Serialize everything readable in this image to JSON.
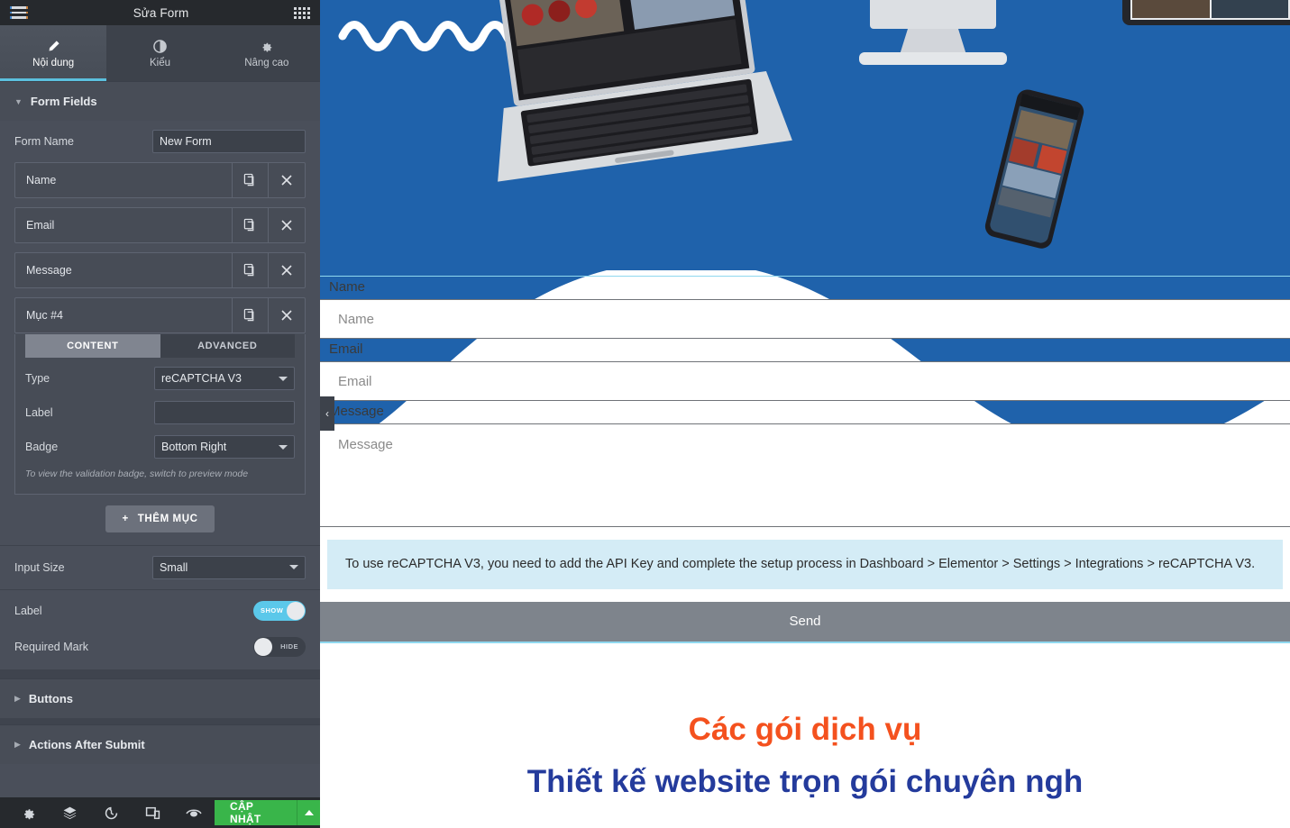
{
  "panel": {
    "header": {
      "title": "Sửa Form",
      "menu_icon": "hamburger-icon",
      "apps_icon": "grid-apps-icon"
    },
    "tabs": [
      {
        "label": "Nội dung",
        "icon": "pencil-icon",
        "active": true
      },
      {
        "label": "Kiểu",
        "icon": "contrast-half-circle-icon",
        "active": false
      },
      {
        "label": "Nâng cao",
        "icon": "gear-icon",
        "active": false
      }
    ],
    "sections": {
      "form_fields": {
        "title": "Form Fields",
        "expanded": true
      },
      "buttons": {
        "title": "Buttons",
        "expanded": false
      },
      "actions_after_submit": {
        "title": "Actions After Submit",
        "expanded": false
      }
    },
    "form_name": {
      "label": "Form Name",
      "value": "New Form"
    },
    "fields": [
      {
        "name": "Name"
      },
      {
        "name": "Email"
      },
      {
        "name": "Message"
      },
      {
        "name": "Mục #4"
      }
    ],
    "editor": {
      "subtabs": [
        {
          "label": "CONTENT",
          "active": true
        },
        {
          "label": "ADVANCED",
          "active": false
        }
      ],
      "type": {
        "label": "Type",
        "value": "reCAPTCHA V3"
      },
      "field_label": {
        "label": "Label",
        "value": ""
      },
      "badge": {
        "label": "Badge",
        "value": "Bottom Right"
      },
      "hint": "To view the validation badge, switch to preview mode"
    },
    "add_item_button": "THÊM MỤC",
    "input_size": {
      "label": "Input Size",
      "value": "Small"
    },
    "label_toggle": {
      "label": "Label",
      "state": "SHOW",
      "on": true
    },
    "required_mark_toggle": {
      "label": "Required Mark",
      "state": "HIDE",
      "on": false
    },
    "toolbar": {
      "icons": [
        {
          "name": "settings-gear-icon"
        },
        {
          "name": "navigator-layers-icon"
        },
        {
          "name": "history-revisions-icon"
        },
        {
          "name": "responsive-mode-icon"
        },
        {
          "name": "preview-eye-icon"
        }
      ],
      "update_button": "CẬP NHẬT",
      "update_arrow": "chevron-up-icon"
    }
  },
  "preview": {
    "collapse_handle": "‹",
    "form": {
      "fields": [
        {
          "label": "Name",
          "placeholder": "Name",
          "type": "text"
        },
        {
          "label": "Email",
          "placeholder": "Email",
          "type": "text"
        },
        {
          "label": "Message",
          "placeholder": "Message",
          "type": "textarea"
        }
      ],
      "captcha_notice": "To use reCAPTCHA V3, you need to add the API Key and complete the setup process in Dashboard > Elementor > Settings > Integrations > reCAPTCHA V3.",
      "submit_label": "Send"
    },
    "headings": {
      "subtitle": "Các gói dịch vụ",
      "title": "Thiết kế website trọn gói chuyên ngh"
    }
  },
  "colors": {
    "hero_blue": "#1f62ab",
    "accent_cyan": "#5bc0de",
    "update_green": "#39b54a",
    "panel_bg": "#4a4f5a",
    "heading_orange": "#f4511e",
    "heading_blue": "#243b9c"
  }
}
